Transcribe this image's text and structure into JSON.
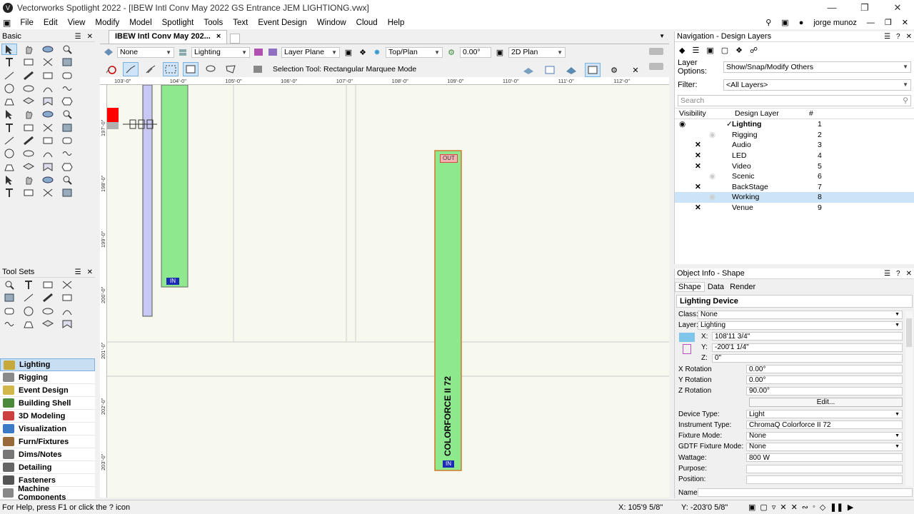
{
  "window": {
    "title": "Vectorworks Spotlight 2022 - [IBEW Intl Conv May 2022 GS Entrance JEM LIGHTIONG.vwx]",
    "app_icon": "V"
  },
  "menu": [
    "File",
    "Edit",
    "View",
    "Modify",
    "Model",
    "Spotlight",
    "Tools",
    "Text",
    "Event Design",
    "Window",
    "Cloud",
    "Help"
  ],
  "user": "jorge munoz",
  "basic_panel": {
    "title": "Basic"
  },
  "toolsets_panel": {
    "title": "Tool Sets"
  },
  "palettes": [
    {
      "label": "Lighting",
      "color": "#c7a83a"
    },
    {
      "label": "Rigging",
      "color": "#8a8a8a"
    },
    {
      "label": "Event Design",
      "color": "#d4b74a"
    },
    {
      "label": "Building Shell",
      "color": "#4a8a3a"
    },
    {
      "label": "3D Modeling",
      "color": "#cc4040"
    },
    {
      "label": "Visualization",
      "color": "#3a7ac7"
    },
    {
      "label": "Furn/Fixtures",
      "color": "#9a6a3a"
    },
    {
      "label": "Dims/Notes",
      "color": "#777777"
    },
    {
      "label": "Detailing",
      "color": "#666666"
    },
    {
      "label": "Fasteners",
      "color": "#555555"
    },
    {
      "label": "Machine Components",
      "color": "#888888"
    }
  ],
  "document_tab": {
    "label": "IBEW Intl Conv May 202...",
    "close": "×"
  },
  "viewbar": {
    "class": "None",
    "layer": "Lighting",
    "plane": "Layer Plane",
    "view": "Top/Plan",
    "angle": "0.00°",
    "render": "2D Plan"
  },
  "mode_label": "Selection Tool: Rectangular Marquee Mode",
  "ruler_h": [
    "103'-0\"",
    "104'-0\"",
    "105'-0\"",
    "106'-0\"",
    "107'-0\"",
    "108'-0\"",
    "109'-0\"",
    "110'-0\"",
    "111'-0\"",
    "112'-0\""
  ],
  "ruler_v": [
    "197'-0\"",
    "198'-0\"",
    "199'-0\"",
    "200'-0\"",
    "201'-0\"",
    "202'-0\"",
    "203'-0\""
  ],
  "drawing": {
    "in_label_left": "IN",
    "out_label": "OUT",
    "in_label_right": "IN",
    "fixture_text": "COLORFORCE II 72"
  },
  "nav": {
    "title": "Navigation - Design Layers",
    "layer_options_label": "Layer Options:",
    "layer_options_value": "Show/Snap/Modify Others",
    "filter_label": "Filter:",
    "filter_value": "<All Layers>",
    "search_placeholder": "Search",
    "col_visibility": "Visibility",
    "col_layer": "Design Layer",
    "col_num": "#",
    "layers": [
      {
        "name": "Lighting",
        "num": "1",
        "vis": "eye",
        "active": "✓",
        "bold": true
      },
      {
        "name": "Rigging",
        "num": "2",
        "vis": "grey"
      },
      {
        "name": "Audio",
        "num": "3",
        "vis": "x"
      },
      {
        "name": "LED",
        "num": "4",
        "vis": "x"
      },
      {
        "name": "Video",
        "num": "5",
        "vis": "x"
      },
      {
        "name": "Scenic",
        "num": "6",
        "vis": "grey"
      },
      {
        "name": "BackStage",
        "num": "7",
        "vis": "x"
      },
      {
        "name": "Working",
        "num": "8",
        "vis": "grey",
        "sel": true
      },
      {
        "name": "Venue",
        "num": "9",
        "vis": "x"
      }
    ]
  },
  "oi": {
    "title": "Object Info - Shape",
    "tabs": [
      "Shape",
      "Data",
      "Render"
    ],
    "object": "Lighting Device",
    "class_label": "Class:",
    "class_value": "None",
    "layer_label": "Layer:",
    "layer_value": "Lighting",
    "x_label": "X:",
    "x_value": "108'11 3/4\"",
    "y_label": "Y:",
    "y_value": "-200'1 1/4\"",
    "z_label": "Z:",
    "z_value": "0\"",
    "fields": [
      {
        "label": "X Rotation",
        "value": "0.00°"
      },
      {
        "label": "Y Rotation",
        "value": "0.00°"
      },
      {
        "label": "Z Rotation",
        "value": "90.00°"
      }
    ],
    "edit": "Edit...",
    "fields2": [
      {
        "label": "Device Type:",
        "value": "Light",
        "dd": true
      },
      {
        "label": "Instrument Type:",
        "value": "ChromaQ Colorforce II 72"
      },
      {
        "label": "Fixture Mode:",
        "value": "None",
        "dd": true
      },
      {
        "label": "GDTF Fixture Mode:",
        "value": "None",
        "dd": true
      },
      {
        "label": "Wattage:",
        "value": "800 W"
      },
      {
        "label": "Purpose:",
        "value": ""
      },
      {
        "label": "Position:",
        "value": ""
      }
    ],
    "name_label": "Name:"
  },
  "status": {
    "help": "For Help, press F1 or click the ? icon",
    "x": "X: 105'9 5/8\"",
    "y": "Y: -203'0 5/8\""
  }
}
